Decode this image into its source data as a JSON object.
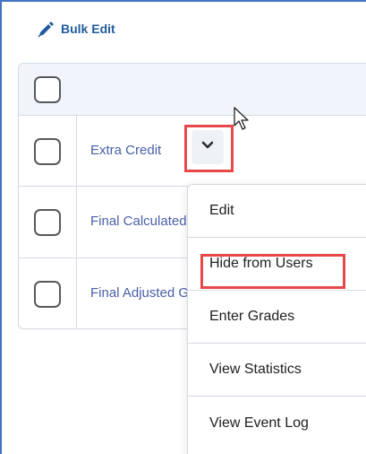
{
  "toolbar": {
    "bulk_edit_label": "Bulk Edit",
    "icon": "pencil-icon",
    "accent_color": "#205b9e"
  },
  "grid": {
    "rows": [
      {
        "label": "Extra Credit"
      },
      {
        "label": "Final Calculated Grade"
      },
      {
        "label": "Final Adjusted Grade"
      }
    ],
    "link_color": "#4a5fa8"
  },
  "context_menu": {
    "items": [
      {
        "label": "Edit"
      },
      {
        "label": "Hide from Users"
      },
      {
        "label": "Enter Grades"
      },
      {
        "label": "View Statistics"
      },
      {
        "label": "View Event Log"
      }
    ],
    "highlighted_item": "Hide from Users"
  },
  "highlight_color": "#e8484a",
  "icons": [
    "pencil-icon",
    "chevron-down-icon",
    "mouse-cursor-icon"
  ]
}
